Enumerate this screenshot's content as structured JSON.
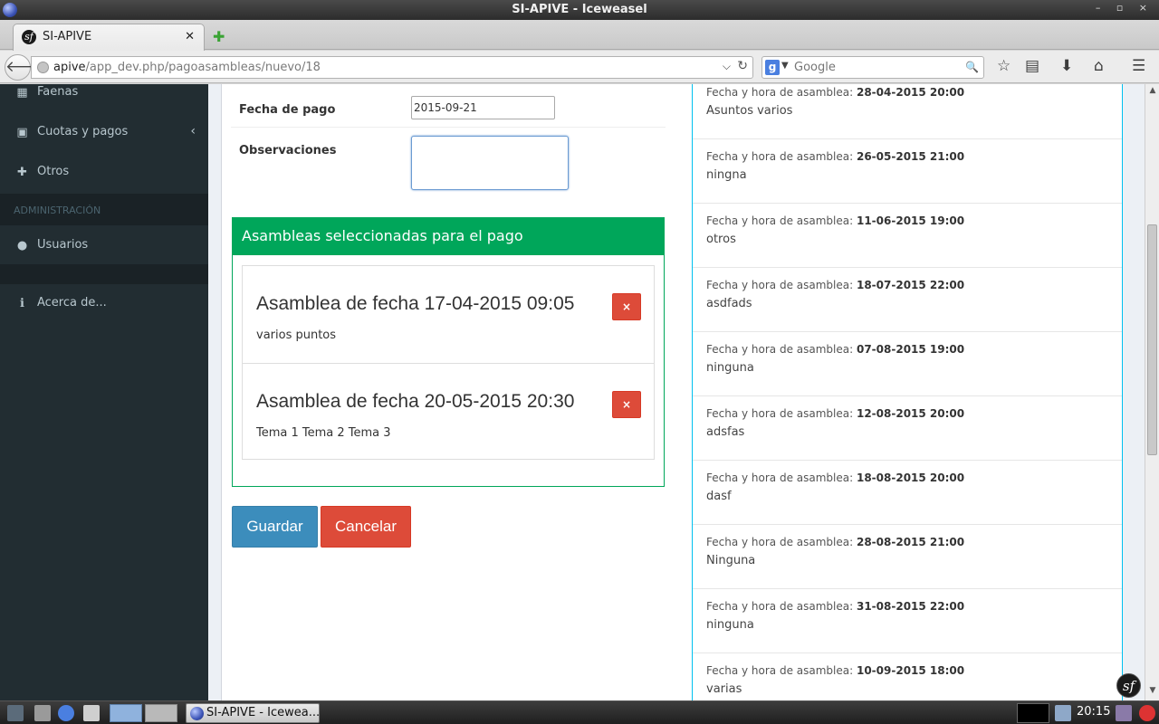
{
  "window": {
    "title": "SI-APIVE - Iceweasel",
    "controls": "– ▫ ×"
  },
  "browser": {
    "tab_label": "SI-APIVE",
    "url_host": "apive",
    "url_path": "/app_dev.php/pagoasambleas/nuevo/18",
    "search_placeholder": "Google"
  },
  "sidebar": {
    "items": [
      {
        "label": "Faenas"
      },
      {
        "label": "Cuotas y pagos"
      },
      {
        "label": "Otros"
      }
    ],
    "section_header": "ADMINISTRACIÓN",
    "admin_items": [
      {
        "label": "Usuarios"
      }
    ],
    "footer_items": [
      {
        "label": "Acerca de..."
      }
    ]
  },
  "form": {
    "fecha_label": "Fecha de pago",
    "fecha_value": "2015-09-21",
    "observaciones_label": "Observaciones",
    "observaciones_value": "",
    "selected_panel_title": "Asambleas seleccionadas para el pago",
    "selected": [
      {
        "title": "Asamblea de fecha 17-04-2015 09:05",
        "description": "varios puntos"
      },
      {
        "title": "Asamblea de fecha 20-05-2015 20:30",
        "description": "Tema 1 Tema 2 Tema 3"
      }
    ],
    "remove_label": "×",
    "save_label": "Guardar",
    "cancel_label": "Cancelar"
  },
  "available_list": {
    "prefix": "Fecha y hora de asamblea: ",
    "items": [
      {
        "datetime": "28-04-2015 20:00",
        "description": "Asuntos varios"
      },
      {
        "datetime": "26-05-2015 21:00",
        "description": "ningna"
      },
      {
        "datetime": "11-06-2015 19:00",
        "description": "otros"
      },
      {
        "datetime": "18-07-2015 22:00",
        "description": "asdfads"
      },
      {
        "datetime": "07-08-2015 19:00",
        "description": "ninguna"
      },
      {
        "datetime": "12-08-2015 20:00",
        "description": "adsfas"
      },
      {
        "datetime": "18-08-2015 20:00",
        "description": "dasf"
      },
      {
        "datetime": "28-08-2015 21:00",
        "description": "Ninguna"
      },
      {
        "datetime": "31-08-2015 22:00",
        "description": "ninguna"
      },
      {
        "datetime": "10-09-2015 18:00",
        "description": "varias"
      }
    ]
  },
  "taskbar": {
    "task_label": "SI-APIVE - Icewea...",
    "clock": "20:15"
  },
  "colors": {
    "sidebar_bg": "#222d32",
    "success": "#00a65a",
    "primary": "#3c8dbc",
    "danger": "#dd4b39",
    "info_border": "#00c0ef"
  }
}
